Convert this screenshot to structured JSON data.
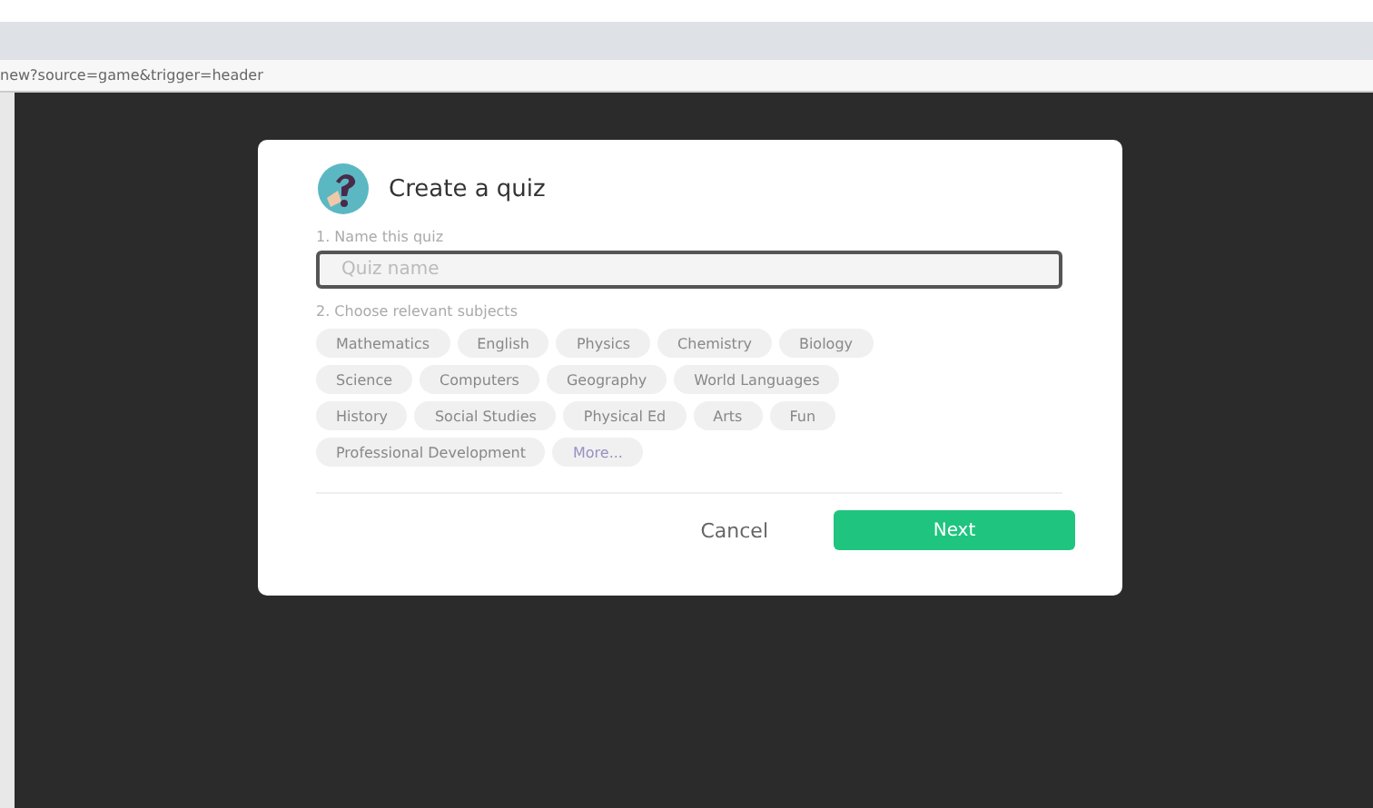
{
  "address_bar": {
    "url": "new?source=game&trigger=header"
  },
  "dialog": {
    "title": "Create a quiz",
    "name_label": "1. Name this quiz",
    "name_field": {
      "placeholder": "Quiz name"
    },
    "subjects_label": "2. Choose relevant subjects",
    "subjects": [
      {
        "label": "Mathematics",
        "kind": "subject"
      },
      {
        "label": "English",
        "kind": "subject"
      },
      {
        "label": "Physics",
        "kind": "subject"
      },
      {
        "label": "Chemistry",
        "kind": "subject"
      },
      {
        "label": "Biology",
        "kind": "subject"
      },
      {
        "label": "Science",
        "kind": "subject"
      },
      {
        "label": "Computers",
        "kind": "subject"
      },
      {
        "label": "Geography",
        "kind": "subject"
      },
      {
        "label": "World Languages",
        "kind": "subject"
      },
      {
        "label": "History",
        "kind": "subject"
      },
      {
        "label": "Social Studies",
        "kind": "subject"
      },
      {
        "label": "Physical Ed",
        "kind": "subject"
      },
      {
        "label": "Arts",
        "kind": "subject"
      },
      {
        "label": "Fun",
        "kind": "subject"
      },
      {
        "label": "Professional Development",
        "kind": "subject"
      },
      {
        "label": "More...",
        "kind": "more"
      }
    ],
    "buttons": {
      "cancel": "Cancel",
      "next": "Next"
    }
  }
}
